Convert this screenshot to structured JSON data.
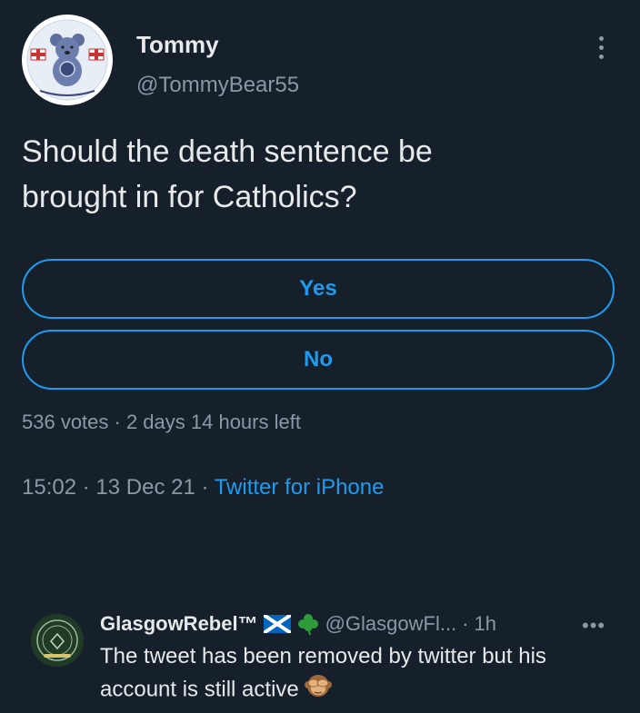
{
  "tweet": {
    "author": {
      "display_name": "Tommy",
      "handle": "@TommyBear55",
      "avatar_icon": "teddy-bear-avatar-icon"
    },
    "text_line1": "Should the death sentence be",
    "text_line2": "brought in for Catholics?",
    "poll": {
      "options": [
        "Yes",
        "No"
      ],
      "meta": "536 votes · 2 days 14 hours left"
    },
    "time": "15:02",
    "date": "13 Dec 21",
    "source": "Twitter for iPhone"
  },
  "reply": {
    "display_name": "GlasgowRebel™",
    "flag_icon": "scotland-flag-icon",
    "clover_icon": "shamrock-icon",
    "handle": "@GlasgowFl...",
    "time": "1h",
    "text": "The tweet has been removed by twitter but his account is still active",
    "trailing_icon": "see-no-evil-monkey-icon"
  },
  "colors": {
    "background": "#15202b",
    "accent": "#1d9bf0",
    "secondary_text": "#8b98a5",
    "primary_text": "#e7e9ea"
  }
}
